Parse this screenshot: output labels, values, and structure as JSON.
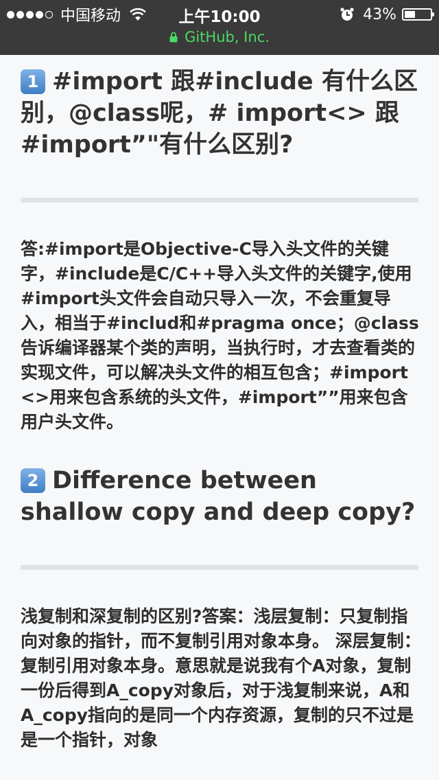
{
  "status_bar": {
    "carrier": "中国移动",
    "time": "上午10:00",
    "battery_percent": "43%",
    "battery_level": 0.43,
    "url": "GitHub, Inc."
  },
  "article": {
    "q1": {
      "number": "1",
      "title": "#import 跟#include 有什么区别，@class呢，# import<> 跟 #import”\"有什么区别?",
      "answer": "答:#import是Objective-C导入头文件的关键字，#include是C/C++导入头文件的关键字,使用#import头文件会自动只导入一次，不会重复导入，相当于#includ和#pragma once；@class告诉编译器某个类的声明，当执行时，才去查看类的实现文件，可以解决头文件的相互包含；#import<>用来包含系统的头文件，#import””用来包含用户头文件。"
    },
    "q2": {
      "number": "2",
      "title": "Difference between shallow copy and deep copy?",
      "answer": "浅复制和深复制的区别?答案：浅层复制：只复制指向对象的指针，而不复制引用对象本身。 深层复制：复制引用对象本身。意思就是说我有个A对象，复制一份后得到A_copy对象后，对于浅复制来说，A和A_copy指向的是同一个内存资源，复制的只不过是是一个指针，对象"
    }
  }
}
